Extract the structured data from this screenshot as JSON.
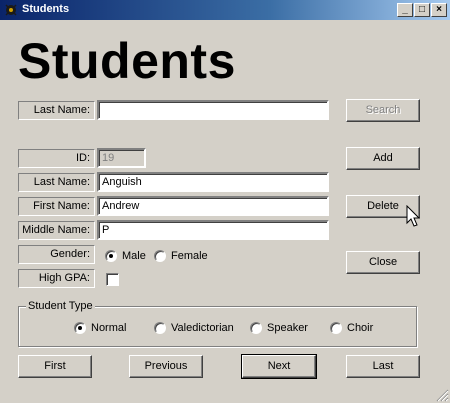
{
  "window": {
    "title": "Students",
    "controls": {
      "minimize": "_",
      "maximize": "□",
      "close": "×"
    }
  },
  "heading": "Students",
  "search": {
    "last_name_label": "Last Name:",
    "last_name_value": "",
    "search_button": "Search"
  },
  "form": {
    "id_label": "ID:",
    "id_value": "19",
    "last_name_label": "Last Name:",
    "last_name_value": "Anguish",
    "first_name_label": "First Name:",
    "first_name_value": "Andrew",
    "middle_name_label": "Middle Name:",
    "middle_name_value": "P",
    "gender_label": "Gender:",
    "gender_options": [
      "Male",
      "Female"
    ],
    "gender_selected": "Male",
    "high_gpa_label": "High GPA:",
    "high_gpa_checked": false
  },
  "actions": {
    "add": "Add",
    "delete": "Delete",
    "close": "Close"
  },
  "student_type": {
    "title": "Student Type",
    "options": [
      "Normal",
      "Valedictorian",
      "Speaker",
      "Choir"
    ],
    "selected": "Normal"
  },
  "navigation": {
    "first": "First",
    "previous": "Previous",
    "next": "Next",
    "last": "Last"
  },
  "icons": {
    "app": "app-icon",
    "cursor": "mouse-pointer-icon",
    "grip": "resize-grip-icon"
  }
}
